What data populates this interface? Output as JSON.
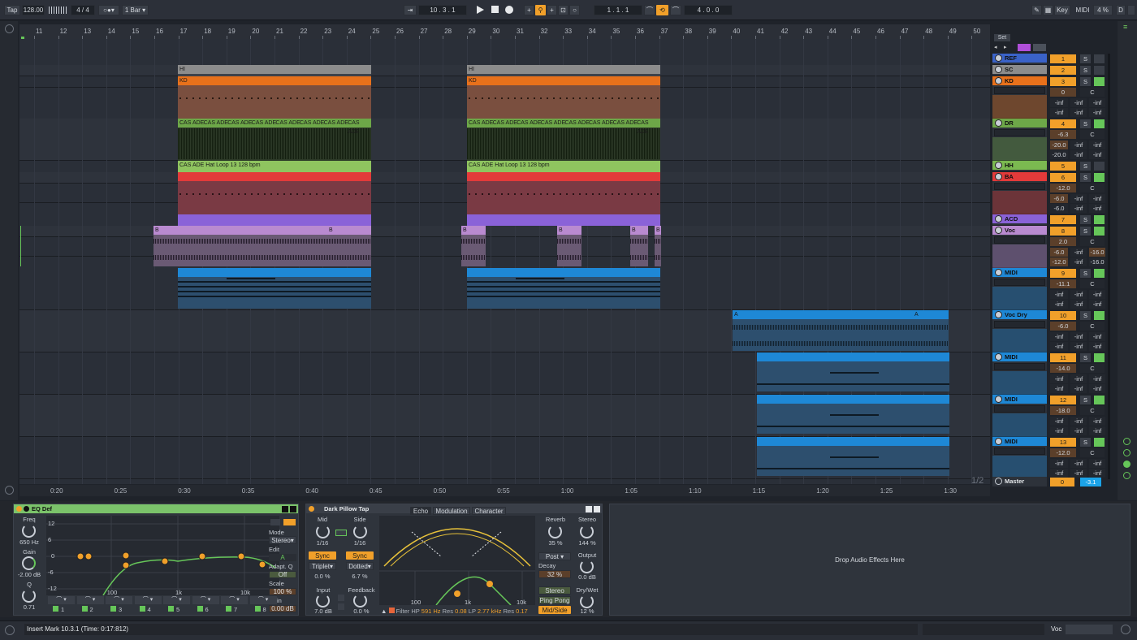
{
  "transport": {
    "tap": "Tap",
    "tempo": "128.00",
    "signature": "4 / 4",
    "quantize": "1 Bar",
    "position": "10 .  3 .  1",
    "loop_start": "1 .  1 .  1",
    "loop_length": "4 .  0 .  0",
    "key_label": "Key",
    "midi_label": "MIDI",
    "cpu": "4 %",
    "d_label": "D"
  },
  "ruler": {
    "bars": [
      "11",
      "12",
      "13",
      "14",
      "15",
      "16",
      "17",
      "18",
      "19",
      "20",
      "21",
      "22",
      "23",
      "24",
      "25",
      "26",
      "27",
      "28",
      "29",
      "30",
      "31",
      "32",
      "33",
      "34",
      "35",
      "36",
      "37",
      "38",
      "39",
      "40",
      "41",
      "42",
      "43",
      "44",
      "45",
      "46",
      "47",
      "48",
      "49",
      "50"
    ]
  },
  "timeline": {
    "marks": [
      "0:20",
      "0:25",
      "0:30",
      "0:35",
      "0:40",
      "0:45",
      "0:50",
      "0:55",
      "1:00",
      "1:05",
      "1:10",
      "1:15",
      "1:20",
      "1:25",
      "1:30"
    ]
  },
  "page_indicator": "1/2",
  "set_label": "Set",
  "clips": {
    "hi": "HI",
    "kd": "KD",
    "cas": "CAS ADE",
    "hat": "CAS ADE Hat Loop 13 128 bpm",
    "b": "B",
    "a": "A"
  },
  "tracks": [
    {
      "name": "REF",
      "num": "1",
      "color": "#3a62c8",
      "vol": "",
      "pan": "",
      "l": "",
      "r": "",
      "x": ""
    },
    {
      "name": "SC",
      "num": "2",
      "color": "#8c8c8c",
      "vol": "",
      "pan": "",
      "l": "",
      "r": "",
      "x": ""
    },
    {
      "name": "KD",
      "num": "3",
      "color": "#e8711b",
      "vol": "0",
      "pan": "C",
      "l": "-inf",
      "r": "-inf",
      "x": "-inf"
    },
    {
      "name": "DR",
      "num": "4",
      "color": "#6da748",
      "vol": "-6.3",
      "pan": "C",
      "l": "-20.0",
      "r": "-inf",
      "x": "-inf"
    },
    {
      "name": "HH",
      "num": "5",
      "color": "#7bb950",
      "vol": "",
      "pan": "",
      "l": "",
      "r": "",
      "x": ""
    },
    {
      "name": "BA",
      "num": "6",
      "color": "#e33a3a",
      "vol": "-12.0",
      "pan": "C",
      "l": "-6.0",
      "r": "-inf",
      "x": "-inf"
    },
    {
      "name": "ACD",
      "num": "7",
      "color": "#8a62d8",
      "vol": "",
      "pan": "",
      "l": "",
      "r": "",
      "x": ""
    },
    {
      "name": "Voc",
      "num": "8",
      "color": "#b98ad0",
      "vol": "2.0",
      "pan": "C",
      "l": "-6.0",
      "r": "-inf",
      "x": "-16.0"
    },
    {
      "name": "MIDI",
      "num": "9",
      "color": "#1e88d6",
      "vol": "-11.1",
      "pan": "C",
      "l": "-inf",
      "r": "-inf",
      "x": "-inf"
    },
    {
      "name": "Voc Dry",
      "num": "10",
      "color": "#1e88d6",
      "vol": "-6.0",
      "pan": "C",
      "l": "-inf",
      "r": "-inf",
      "x": "-inf"
    },
    {
      "name": "MIDI",
      "num": "11",
      "color": "#1e88d6",
      "vol": "-14.0",
      "pan": "C",
      "l": "-inf",
      "r": "-inf",
      "x": "-inf"
    },
    {
      "name": "MIDI",
      "num": "12",
      "color": "#1e88d6",
      "vol": "-18.0",
      "pan": "C",
      "l": "-inf",
      "r": "-inf",
      "x": "-inf"
    },
    {
      "name": "MIDI",
      "num": "13",
      "color": "#1e88d6",
      "vol": "-12.0",
      "pan": "C",
      "l": "-inf",
      "r": "-inf",
      "x": "-inf"
    }
  ],
  "extra": {
    "voc_r": "-12.0",
    "s": "S",
    "master": "Master",
    "master_vol": "0",
    "master_peak": "-3.1"
  },
  "eq": {
    "title": "EQ Def",
    "freq_label": "Freq",
    "freq": "650 Hz",
    "gain_label": "Gain",
    "gain": "-2.00 dB",
    "q_label": "Q",
    "q": "0.71",
    "db_ticks": [
      "12",
      "6",
      "0",
      "-6",
      "-12"
    ],
    "freq_ticks": [
      "100",
      "1k",
      "10k"
    ],
    "mode_label": "Mode",
    "mode": "Stereo",
    "edit_label": "Edit",
    "edit": "A",
    "adapt_label": "Adapt. Q",
    "adapt": "Off",
    "scale_label": "Scale",
    "scale": "100 %",
    "out_gain_label": "Gain",
    "out_gain": "0.00 dB",
    "bands": [
      "1",
      "2",
      "3",
      "4",
      "5",
      "6",
      "7",
      "8"
    ]
  },
  "delay": {
    "title": "Dark Pillow Tap",
    "mid_label": "Mid",
    "mid": "1/16",
    "side_label": "Side",
    "side": "1/16",
    "sync": "Sync",
    "triplet": "Triplet",
    "dotted": "Dotted",
    "mid_offset": "0.0 %",
    "side_offset": "6.7 %",
    "input_label": "Input",
    "input": "7.0 dB",
    "feedback_label": "Feedback",
    "feedback": "0.0 %",
    "tabs": [
      "Echo",
      "Modulation",
      "Character"
    ],
    "reverb_label": "Reverb",
    "reverb": "35 %",
    "stereo_label": "Stereo",
    "stereo": "144 %",
    "post": "Post",
    "decay_label": "Decay",
    "decay": "32 %",
    "output_label": "Output",
    "output": "0.0 dB",
    "mode_stereo": "Stereo",
    "mode_pingpong": "Ping Pong",
    "mode_midside": "Mid/Side",
    "drywet_label": "Dry/Wet",
    "drywet": "12 %",
    "filter": "Filter",
    "hp": "HP",
    "hp_val": "591 Hz",
    "res1_label": "Res",
    "res1": "0.08",
    "lp": "LP",
    "lp_val": "2.77 kHz",
    "res2_label": "Res",
    "res2": "0.17",
    "freq_ticks": [
      "100",
      "1k",
      "10k"
    ]
  },
  "drop_text": "Drop Audio Effects Here",
  "status": "Insert Mark 10.3.1 (Time: 0:17:812)",
  "status_track": "Voc"
}
